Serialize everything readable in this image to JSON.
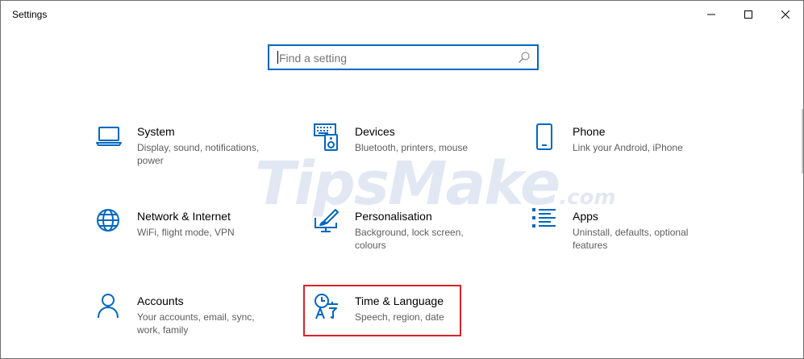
{
  "window": {
    "title": "Settings",
    "controls": [
      "minimize-icon",
      "maximize-icon",
      "close-icon"
    ]
  },
  "search": {
    "placeholder": "Find a setting",
    "icon": "search-icon"
  },
  "watermark": {
    "main": "TipsMake",
    "suffix": ".com"
  },
  "tiles": [
    {
      "title": "System",
      "desc": "Display, sound, notifications, power",
      "icon": "laptop-icon"
    },
    {
      "title": "Devices",
      "desc": "Bluetooth, printers, mouse",
      "icon": "keyboard-speaker-icon"
    },
    {
      "title": "Phone",
      "desc": "Link your Android, iPhone",
      "icon": "phone-icon"
    },
    {
      "title": "Network & Internet",
      "desc": "WiFi, flight mode, VPN",
      "icon": "globe-icon"
    },
    {
      "title": "Personalisation",
      "desc": "Background, lock screen, colours",
      "icon": "paint-brush-icon"
    },
    {
      "title": "Apps",
      "desc": "Uninstall, defaults, optional features",
      "icon": "apps-list-icon"
    },
    {
      "title": "Accounts",
      "desc": "Your accounts, email, sync, work, family",
      "icon": "person-icon"
    },
    {
      "title": "Time & Language",
      "desc": "Speech, region, date",
      "icon": "time-language-icon"
    }
  ],
  "colors": {
    "accent": "#0067c0",
    "highlight": "#d7232a",
    "secondary_text": "#5d5d5d"
  }
}
